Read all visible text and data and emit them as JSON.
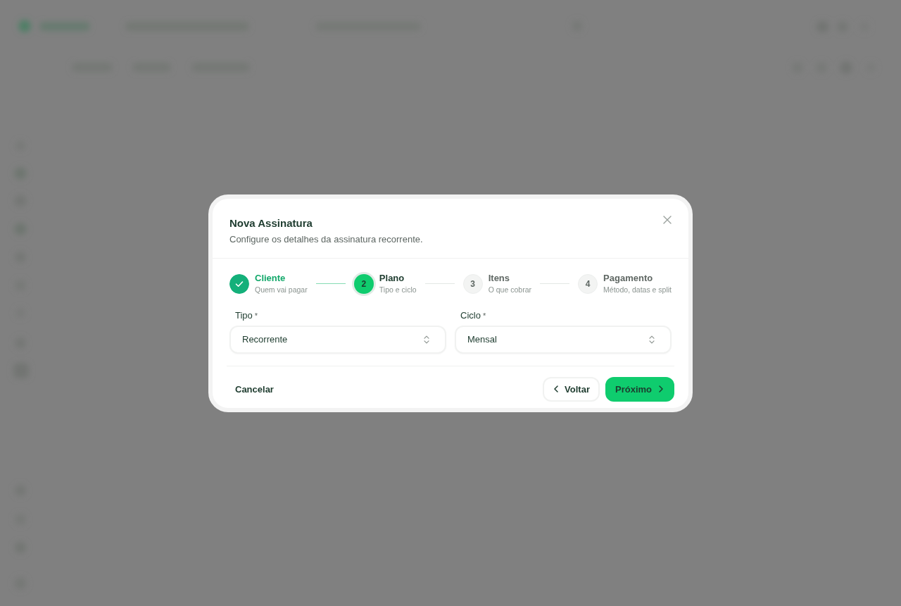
{
  "dialog": {
    "title": "Nova Assinatura",
    "subtitle": "Configure os detalhes da assinatura recorrente.",
    "steps": [
      {
        "label": "Cliente",
        "caption": "Quem vai pagar",
        "completed": true,
        "selected": false
      },
      {
        "number": "2",
        "label": "Plano",
        "caption": "Tipo e ciclo",
        "completed": false,
        "selected": true
      },
      {
        "number": "3",
        "label": "Itens",
        "caption": "O que cobrar",
        "completed": false,
        "selected": false
      },
      {
        "number": "4",
        "label": "Pagamento",
        "caption": "Método, datas e split",
        "completed": false,
        "selected": false
      }
    ],
    "fields": [
      {
        "label": "Tipo",
        "required_mark": "*",
        "value": "Recorrente"
      },
      {
        "label": "Ciclo",
        "required_mark": "*",
        "value": "Mensal"
      }
    ],
    "footer": {
      "cancel": "Cancelar",
      "back": "Voltar",
      "next": "Próximo"
    }
  }
}
